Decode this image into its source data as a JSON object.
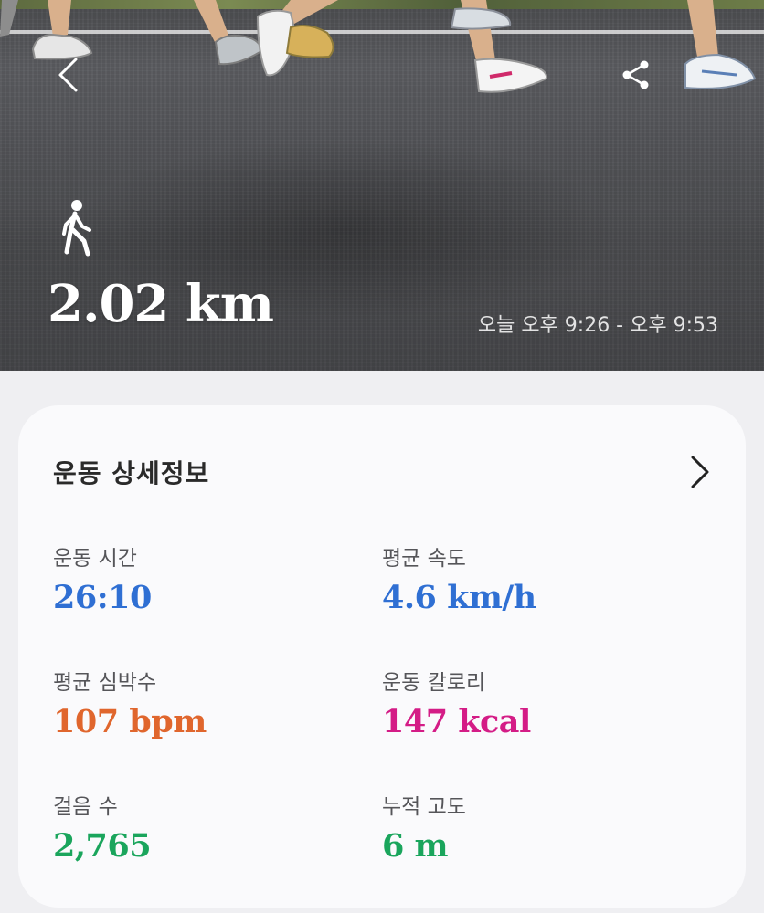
{
  "hero": {
    "activity_icon": "walking-person-icon",
    "distance": "2.02 km",
    "time_range": "오늘 오후 9:26 - 오후 9:53"
  },
  "toolbar": {
    "back_icon": "chevron-left-icon",
    "share_icon": "share-icon"
  },
  "details": {
    "title": "운동 상세정보",
    "chevron_icon": "chevron-right-icon",
    "stats": [
      {
        "label": "운동 시간",
        "value": "26:10",
        "color": "#2f6fd3"
      },
      {
        "label": "평균 속도",
        "value": "4.6 km/h",
        "color": "#2f6fd3"
      },
      {
        "label": "평균 심박수",
        "value": "107 bpm",
        "color": "#e0662d"
      },
      {
        "label": "운동 칼로리",
        "value": "147 kcal",
        "color": "#d41c86"
      },
      {
        "label": "걸음 수",
        "value": "2,765",
        "color": "#1aa55c"
      },
      {
        "label": "누적 고도",
        "value": "6 m",
        "color": "#1aa55c"
      }
    ]
  }
}
